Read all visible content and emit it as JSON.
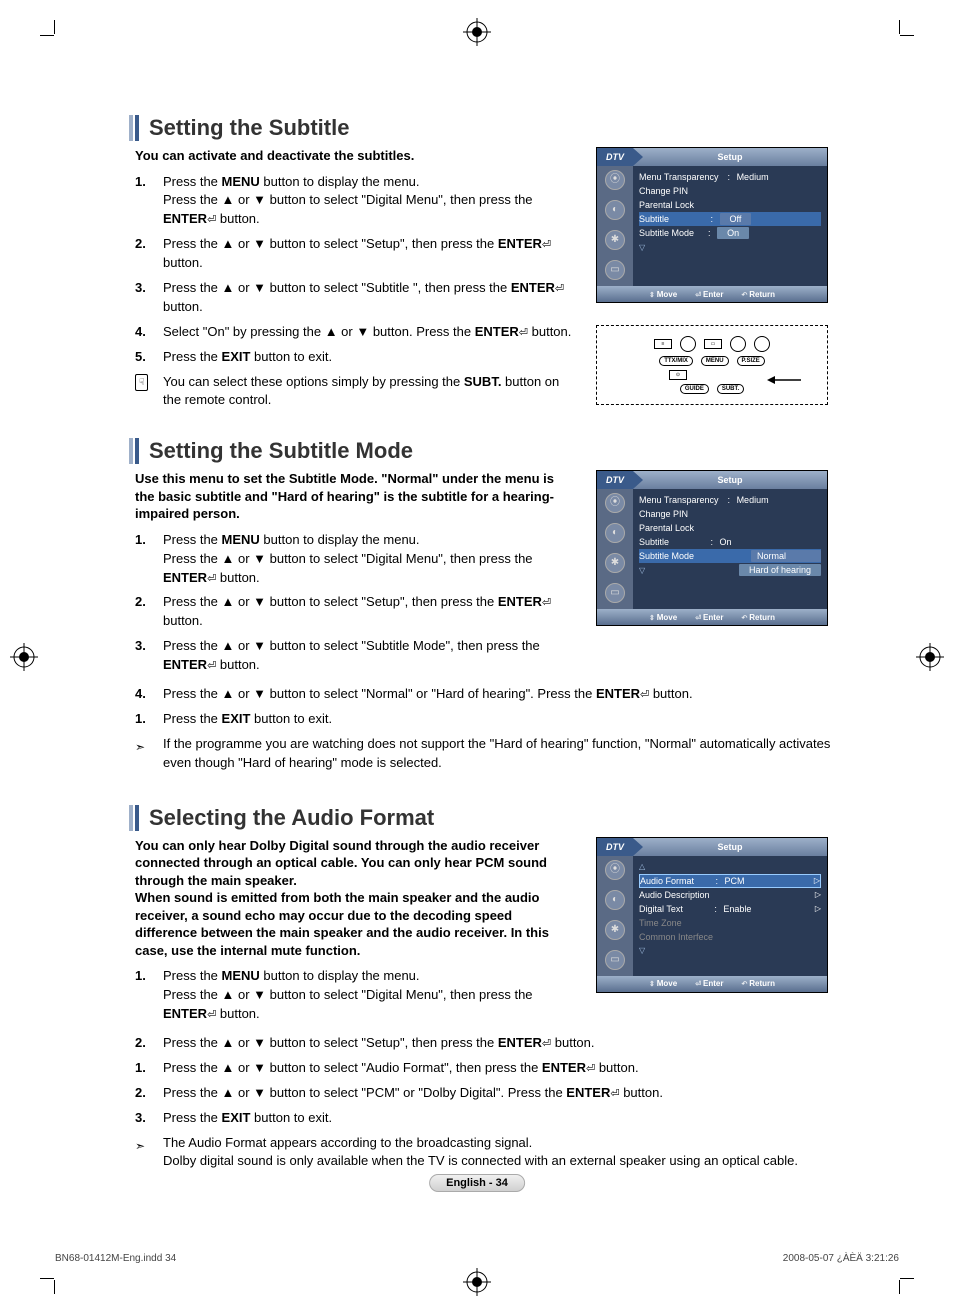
{
  "section1": {
    "title": "Setting the Subtitle",
    "intro": "You can activate and deactivate the subtitles.",
    "steps": {
      "s1a": "Press the ",
      "s1_menu": "MENU",
      "s1b": " button to display the menu.",
      "s1c": "Press the ▲ or ▼ button to select \"Digital Menu\", then press the ",
      "s1_enter": "ENTER",
      "s1d": " button.",
      "s2a": "Press the ▲ or ▼ button to select \"Setup\", then press the ",
      "s2b": " button.",
      "s3a": "Press the ▲ or ▼ button to select \"Subtitle \", then press the ",
      "s3b": " button.",
      "s4a": "Select \"On\" by pressing the ▲ or ▼ button. Press the ",
      "s4b": " button.",
      "s5a": "Press the ",
      "s5_exit": "EXIT",
      "s5b": " button to exit.",
      "note_a": "You can select these options simply by pressing the ",
      "note_subt": "SUBT.",
      "note_b": " button on the remote control."
    }
  },
  "osd1": {
    "badge": "DTV",
    "title": "Setup",
    "rows": {
      "r1": "Menu Transparency",
      "v1": "Medium",
      "r2": "Change PIN",
      "r3": "Parental Lock",
      "r4": "Subtitle",
      "r5": "Subtitle  Mode",
      "opt_off": "Off",
      "opt_on": "On"
    },
    "footer": {
      "move": "Move",
      "enter": "Enter",
      "ret": "Return"
    }
  },
  "remote": {
    "ttx": "TTX/MIX",
    "menu": "MENU",
    "psize": "P.SIZE",
    "guide": "GUIDE",
    "subt": "SUBT."
  },
  "section2": {
    "title": "Setting the Subtitle Mode",
    "intro": "Use this menu to set the Subtitle Mode. \"Normal\" under the menu is the basic subtitle and \"Hard of hearing\" is the subtitle for a hearing-impaired person.",
    "steps": {
      "s3a": "Press the ▲ or ▼ button to select \"Subtitle  Mode\", then press the ",
      "s3b": " button.",
      "s4a": "Press the ▲ or ▼ button to select \"Normal\" or \"Hard of hearing\". Press the ",
      "s4b": " button.",
      "arrow": "If the programme you are watching does not support the \"Hard of hearing\" function, \"Normal\" automatically activates even though \"Hard of hearing\" mode is selected."
    }
  },
  "osd2": {
    "rows": {
      "r4v": "On",
      "opt_normal": "Normal",
      "opt_hard": "Hard of hearing"
    }
  },
  "section3": {
    "title": "Selecting the Audio Format",
    "intro1": "You can only hear Dolby Digital sound through the audio receiver connected through an optical cable. You can only hear PCM sound through the main speaker.",
    "intro2": "When sound is emitted from both the main speaker and the audio receiver, a sound echo may occur due to the decoding speed difference between the main speaker and the audio receiver. In this case, use the internal mute function.",
    "steps": {
      "s3a": "Press the ▲ or ▼ button to select \"Audio Format\", then press the ",
      "s3b": " button.",
      "s4a": "Press the ▲ or ▼ button to select \"PCM\" or \"Dolby Digital\". Press the ",
      "s4b": " button.",
      "arrow1": "The Audio Format appears according to the broadcasting signal.",
      "arrow2": "Dolby digital sound is only available when the TV is connected with an external speaker using an optical cable."
    }
  },
  "osd3": {
    "rows": {
      "r1": "Audio Format",
      "v1": "PCM",
      "r2": "Audio Description",
      "r3": "Digital Text",
      "v3": "Enable",
      "r4": "Time Zone",
      "r5": "Common Interfece"
    }
  },
  "page_label": "English - 34",
  "footer_left": "BN68-01412M-Eng.indd   34",
  "footer_right": "2008-05-07   ¿ÀÈÄ 3:21:26"
}
